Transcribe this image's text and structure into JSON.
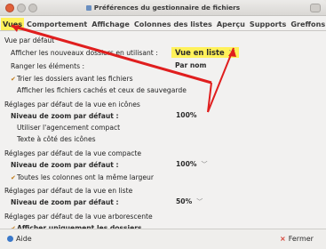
{
  "window": {
    "title": "Préférences du gestionnaire de fichiers"
  },
  "tabs": [
    {
      "label": "Vues",
      "active": true
    },
    {
      "label": "Comportement",
      "active": false
    },
    {
      "label": "Affichage",
      "active": false
    },
    {
      "label": "Colonnes des listes",
      "active": false
    },
    {
      "label": "Aperçu",
      "active": false
    },
    {
      "label": "Supports",
      "active": false
    },
    {
      "label": "Greffons",
      "active": false
    }
  ],
  "default_view": {
    "section": "Vue par défaut",
    "display_label": "Afficher les nouveaux dossiers en utilisant :",
    "display_value": "Vue en liste",
    "arrange_label": "Ranger les éléments :",
    "arrange_value": "Par nom",
    "sort_folders": "Trier les dossiers avant les fichiers",
    "show_hidden": "Afficher les fichiers cachés et ceux de sauvegarde"
  },
  "icon_view": {
    "section": "Réglages par défaut de la vue en icônes",
    "zoom_label": "Niveau de zoom par défaut :",
    "zoom_value": "100%",
    "compact": "Utiliser l'agencement compact",
    "text_beside": "Texte à côté des icônes"
  },
  "compact_view": {
    "section": "Réglages par défaut de la vue compacte",
    "zoom_label": "Niveau de zoom par défaut :",
    "zoom_value": "100%",
    "same_width": "Toutes les colonnes ont la même largeur"
  },
  "list_view": {
    "section": "Réglages par défaut de la vue en liste",
    "zoom_label": "Niveau de zoom par défaut :",
    "zoom_value": "50%"
  },
  "tree_view": {
    "section": "Réglages par défaut de la vue arborescente",
    "only_folders": "Afficher uniquement les dossiers"
  },
  "footer": {
    "help_label": "Aide",
    "close_label": "Fermer"
  },
  "colors": {
    "highlight": "#fff15a",
    "annotation": "#e01e1e",
    "check": "#c07a17"
  }
}
